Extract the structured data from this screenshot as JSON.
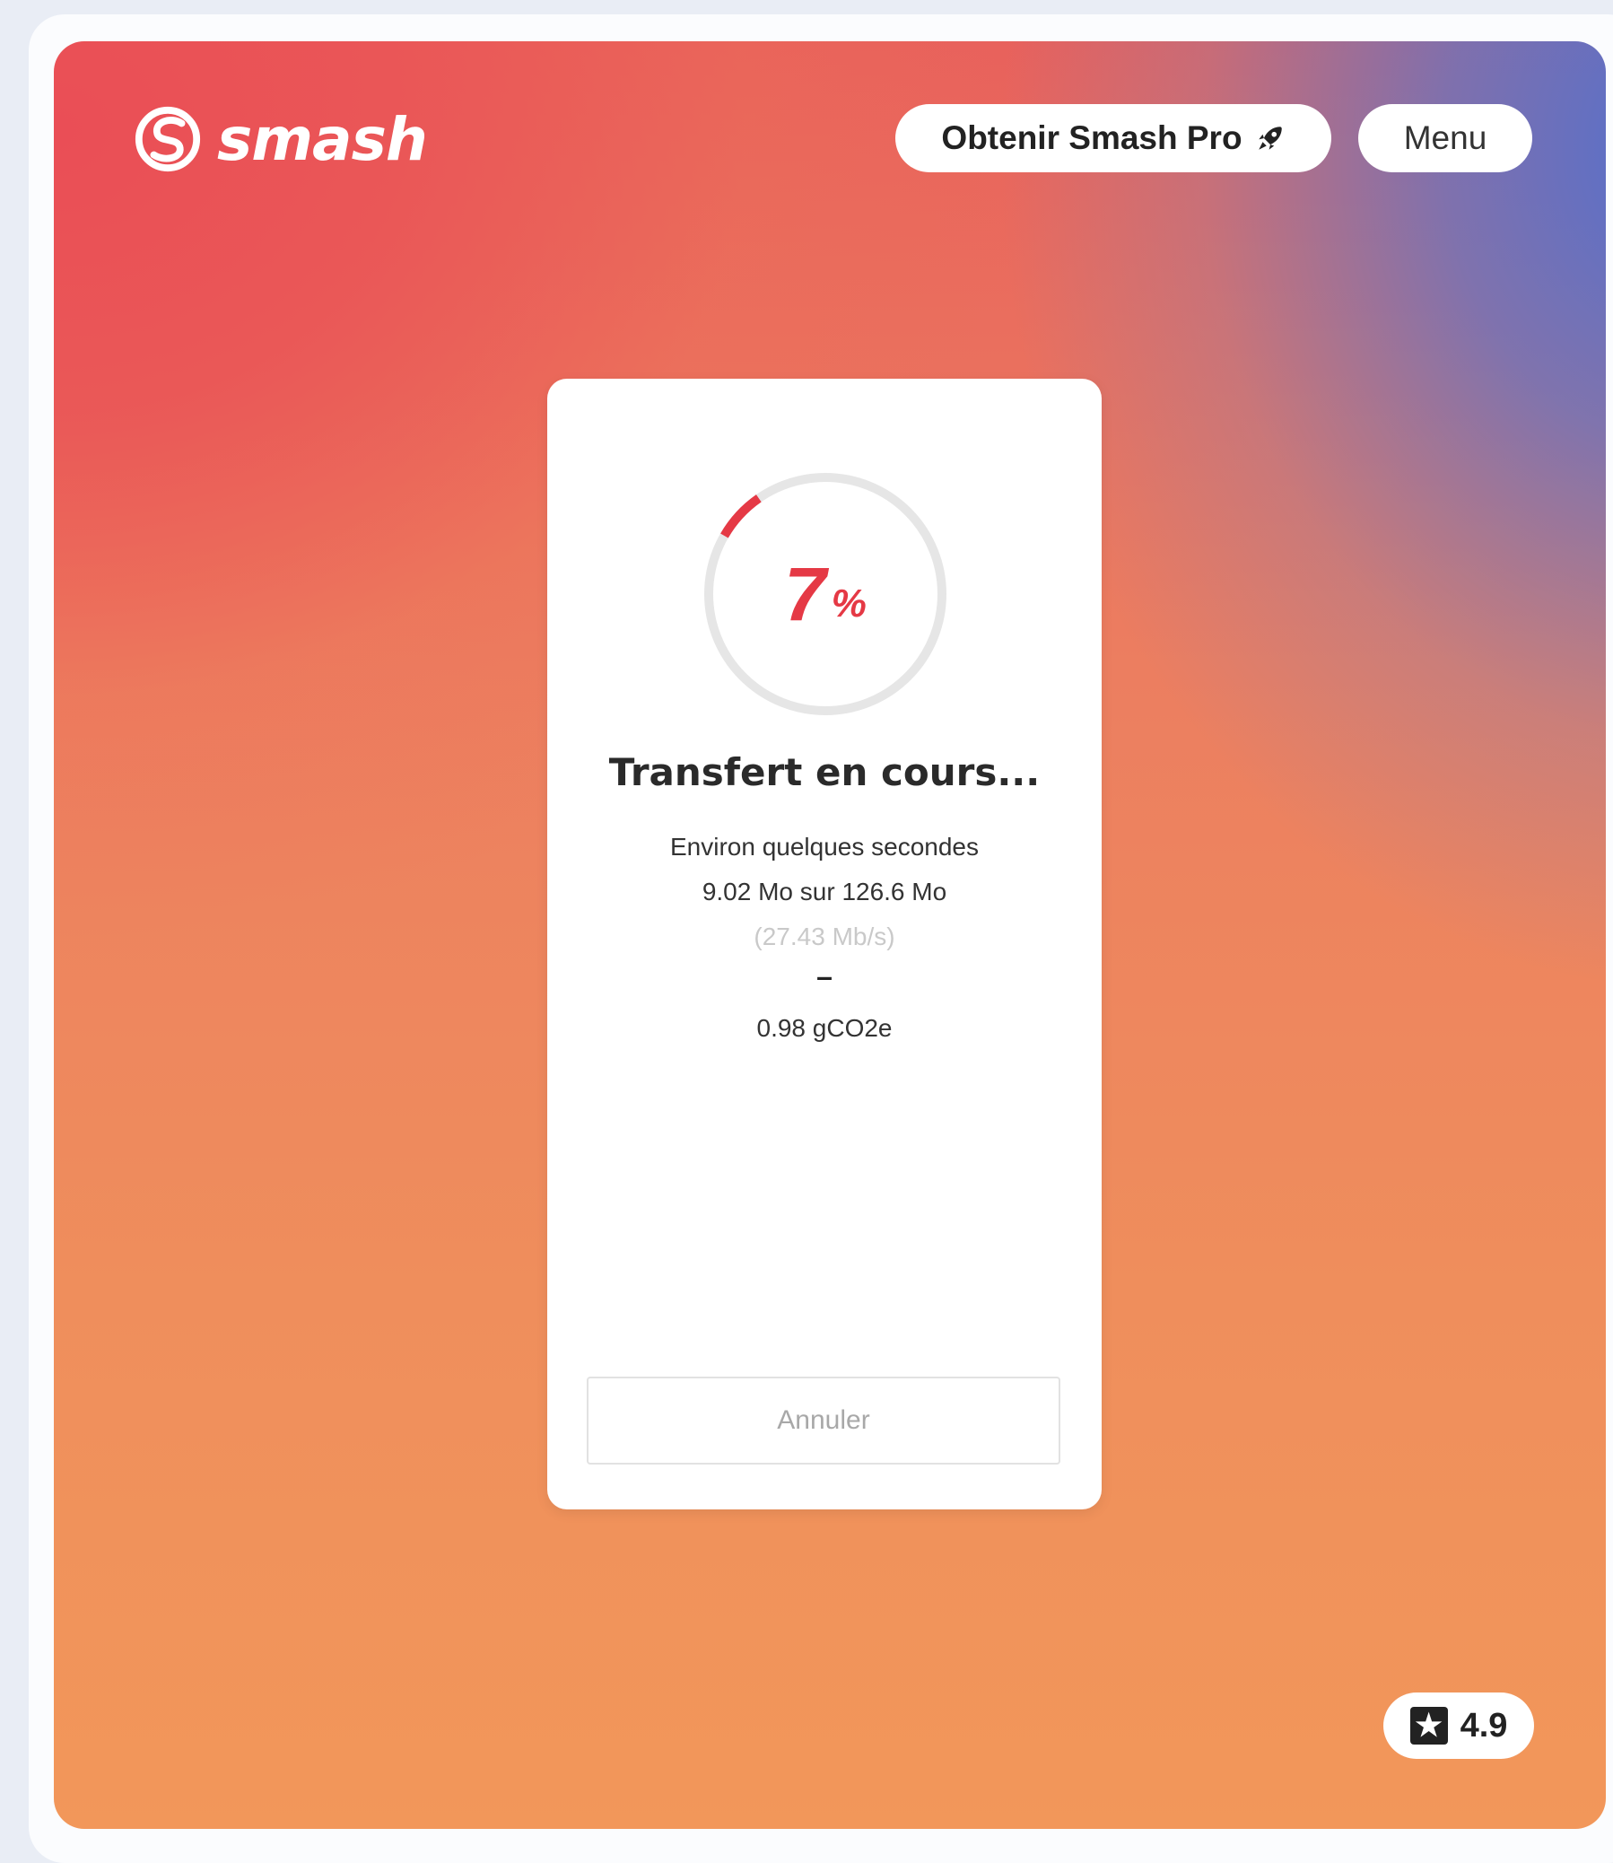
{
  "brand": {
    "name": "smash",
    "icon": "smash-logo-icon"
  },
  "header": {
    "pro_button_label": "Obtenir Smash Pro",
    "pro_button_icon": "rocket-icon",
    "menu_button_label": "Menu"
  },
  "transfer": {
    "progress_value": "7",
    "progress_unit": "%",
    "progress_fraction": 0.07,
    "title": "Transfert en cours...",
    "eta": "Environ quelques secondes",
    "size": "9.02 Mo sur 126.6 Mo",
    "speed": "(27.43 Mb/s)",
    "separator": "–",
    "carbon": "0.98 gCO2e",
    "cancel_label": "Annuler"
  },
  "rating": {
    "icon": "star-icon",
    "value": "4.9"
  },
  "colors": {
    "accent": "#e53945",
    "ring_track": "#e6e6e6"
  }
}
